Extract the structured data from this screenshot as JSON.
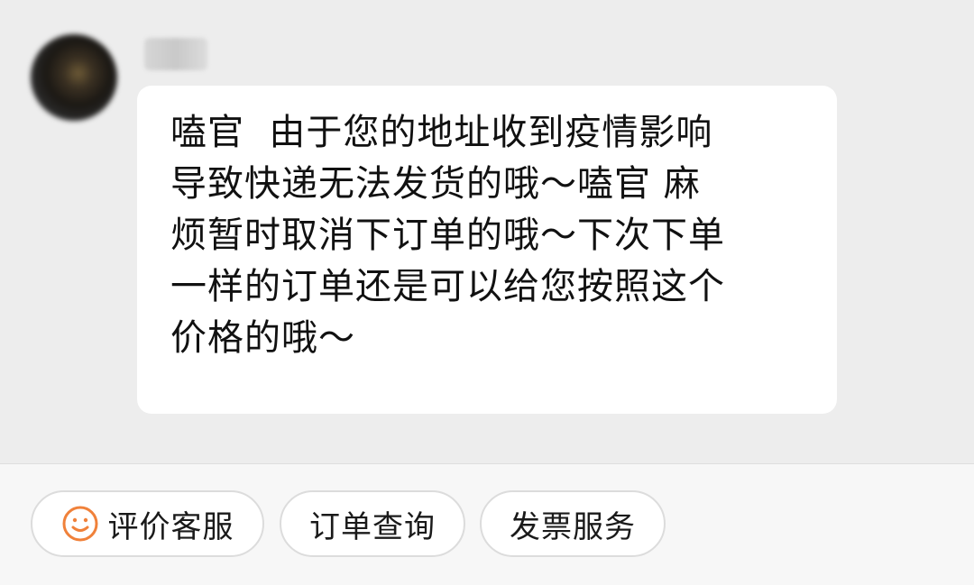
{
  "chat": {
    "sender_name": "明明",
    "message_lines": [
      "嗑官  由于您的地址收到疫情影响",
      "导致快递无法发货的哦～嗑官 麻",
      "烦暂时取消下订单的哦～下次下单",
      "一样的订单还是可以给您按照这个",
      "价格的哦～"
    ]
  },
  "quick_actions": {
    "rate_service": "评价客服",
    "order_query": "订单查询",
    "invoice_service": "发票服务"
  },
  "icons": {
    "rate_service_icon": "smiley-face-icon",
    "accent_color": "#f0813a"
  }
}
